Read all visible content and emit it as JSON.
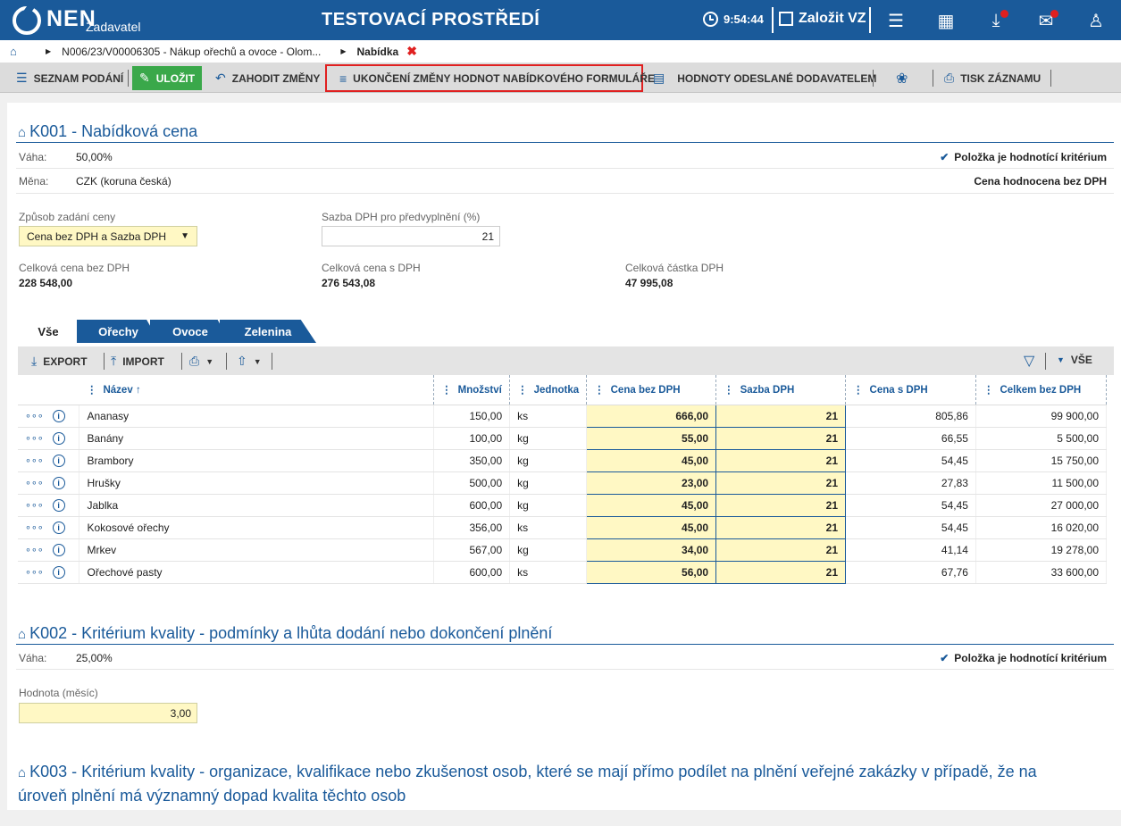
{
  "header": {
    "logo_text": "NEN",
    "logo_sub": "Zadavatel",
    "env_title": "TESTOVACÍ PROSTŘEDÍ",
    "time": "9:54:44",
    "new_vz": "Založit VZ"
  },
  "breadcrumb": {
    "path": "N006/23/V00006305 - Nákup ořechů a ovoce - Olom...",
    "current": "Nabídka",
    "close": "✖"
  },
  "toolbar": {
    "list": "SEZNAM PODÁNÍ",
    "save": "ULOŽIT",
    "discard": "ZAHODIT ZMĚNY",
    "end_change": "UKONČENÍ ZMĚNY HODNOT NABÍDKOVÉHO FORMULÁŘE",
    "sent_values": "HODNOTY ODESLANÉ DODAVATELEM",
    "print": "TISK ZÁZNAMU"
  },
  "k001": {
    "title": "K001 - Nabídková cena",
    "weight_label": "Váha:",
    "weight": "50,00%",
    "currency_label": "Měna:",
    "currency": "CZK (koruna česká)",
    "criterion": "Položka je hodnotící kritérium",
    "evaluated": "Cena hodnocena bez DPH",
    "price_mode_label": "Způsob zadání ceny",
    "price_mode": "Cena bez DPH a Sazba DPH",
    "vat_rate_label": "Sazba DPH pro předvyplnění (%)",
    "vat_rate": "21",
    "total_novat_label": "Celková cena bez DPH",
    "total_novat": "228 548,00",
    "total_vat_label": "Celková cena s DPH",
    "total_vat": "276 543,08",
    "vat_amount_label": "Celková částka DPH",
    "vat_amount": "47 995,08"
  },
  "tabs": [
    "Vše",
    "Ořechy",
    "Ovoce",
    "Zelenina"
  ],
  "grid": {
    "export": "EXPORT",
    "import": "IMPORT",
    "filter_all": "VŠE",
    "columns": [
      "Název",
      "Množství",
      "Jednotka",
      "Cena bez DPH",
      "Sazba DPH",
      "Cena s DPH",
      "Celkem bez DPH"
    ],
    "sort_arrow": "↑",
    "rows": [
      [
        "Ananasy",
        "150,00",
        "ks",
        "666,00",
        "21",
        "805,86",
        "99 900,00"
      ],
      [
        "Banány",
        "100,00",
        "kg",
        "55,00",
        "21",
        "66,55",
        "5 500,00"
      ],
      [
        "Brambory",
        "350,00",
        "kg",
        "45,00",
        "21",
        "54,45",
        "15 750,00"
      ],
      [
        "Hrušky",
        "500,00",
        "kg",
        "23,00",
        "21",
        "27,83",
        "11 500,00"
      ],
      [
        "Jablka",
        "600,00",
        "kg",
        "45,00",
        "21",
        "54,45",
        "27 000,00"
      ],
      [
        "Kokosové ořechy",
        "356,00",
        "ks",
        "45,00",
        "21",
        "54,45",
        "16 020,00"
      ],
      [
        "Mrkev",
        "567,00",
        "kg",
        "34,00",
        "21",
        "41,14",
        "19 278,00"
      ],
      [
        "Ořechové pasty",
        "600,00",
        "ks",
        "56,00",
        "21",
        "67,76",
        "33 600,00"
      ]
    ]
  },
  "k002": {
    "title": "K002 - Kritérium kvality - podmínky a lhůta dodání nebo dokončení plnění",
    "weight_label": "Váha:",
    "weight": "25,00%",
    "criterion": "Položka je hodnotící kritérium",
    "value_label": "Hodnota (měsíc)",
    "value": "3,00"
  },
  "k003": {
    "title_line1": "K003 - Kritérium kvality - organizace, kvalifikace nebo zkušenost osob, které se mají přímo podílet na plnění veřejné zakázky v případě, že na",
    "title_line2": "úroveň plnění má významný dopad kvalita těchto osob"
  },
  "colors": {
    "brand": "#1a5a9a",
    "save": "#3aa84a",
    "highlight": "#e02020",
    "editable": "#fff8c4"
  }
}
